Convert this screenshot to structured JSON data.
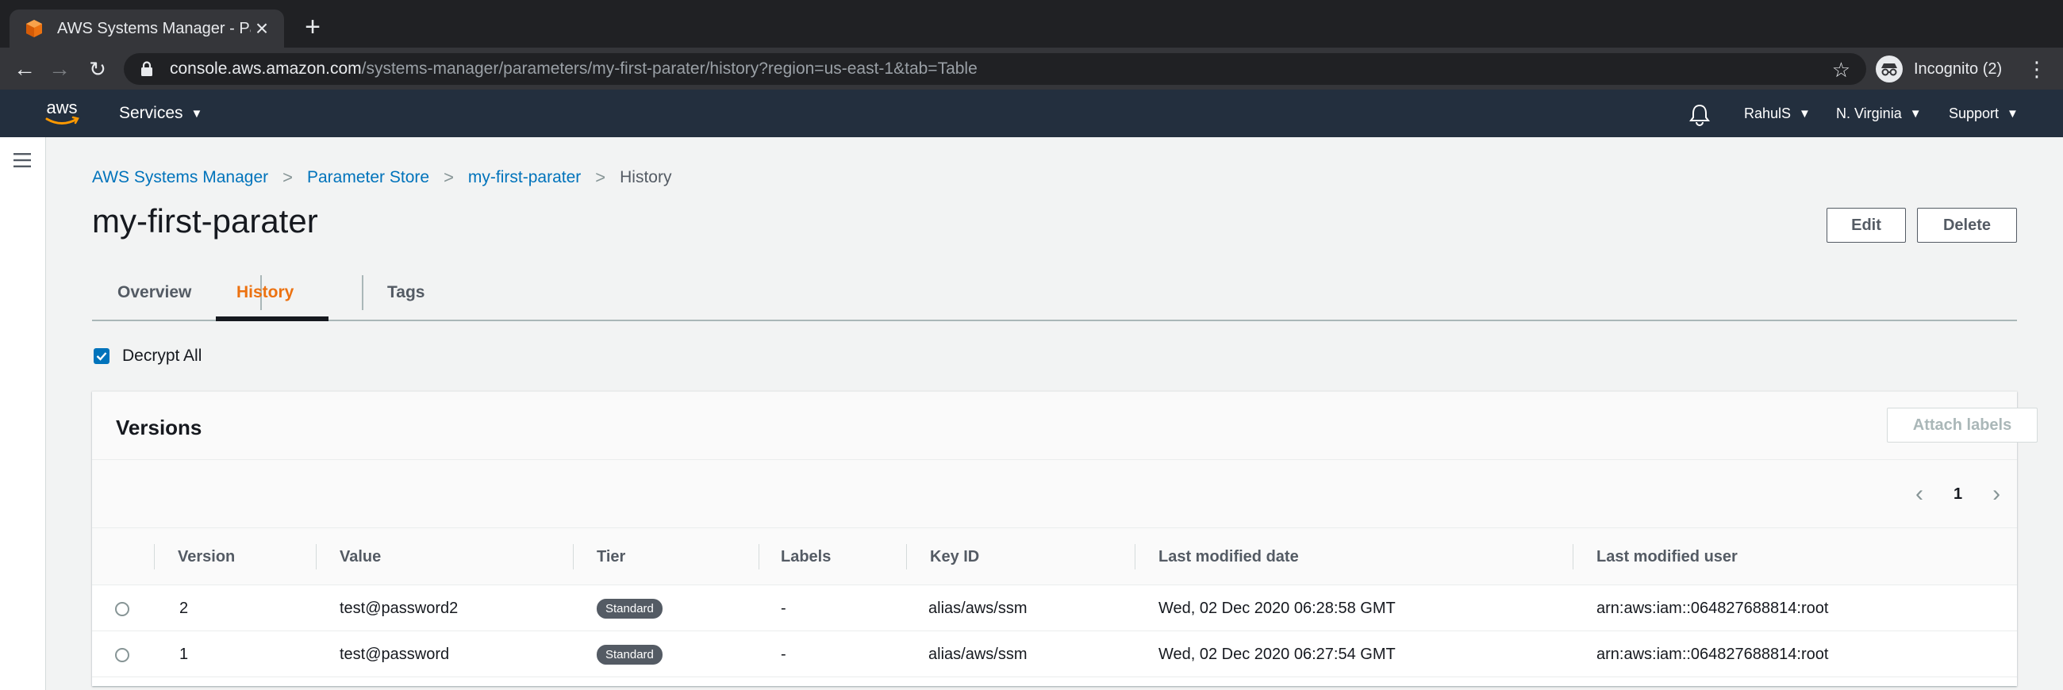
{
  "browser": {
    "tab_title": "AWS Systems Manager - Paran",
    "url_host": "console.aws.amazon.com",
    "url_path": "/systems-manager/parameters/my-first-parater/history?region=us-east-1&tab=Table",
    "incognito_label": "Incognito (2)"
  },
  "awsbar": {
    "logo_text": "aws",
    "services_label": "Services",
    "user_label": "RahulS",
    "region_label": "N. Virginia",
    "support_label": "Support"
  },
  "breadcrumb": [
    {
      "label": "AWS Systems Manager"
    },
    {
      "label": "Parameter Store"
    },
    {
      "label": "my-first-parater"
    },
    {
      "label": "History"
    }
  ],
  "page": {
    "title": "my-first-parater",
    "edit_label": "Edit",
    "delete_label": "Delete"
  },
  "tabs": [
    {
      "label": "Overview",
      "active": false
    },
    {
      "label": "History",
      "active": true
    },
    {
      "label": "Tags",
      "active": false
    }
  ],
  "decrypt": {
    "label": "Decrypt All",
    "checked": true
  },
  "versions": {
    "title": "Versions",
    "attach_label": "Attach labels",
    "current_page": "1",
    "columns": [
      "Version",
      "Value",
      "Tier",
      "Labels",
      "Key ID",
      "Last modified date",
      "Last modified user"
    ],
    "rows": [
      {
        "version": "2",
        "value": "test@password2",
        "tier": "Standard",
        "labels": "-",
        "key_id": "alias/aws/ssm",
        "date": "Wed, 02 Dec 2020 06:28:58 GMT",
        "user": "arn:aws:iam::064827688814:root"
      },
      {
        "version": "1",
        "value": "test@password",
        "tier": "Standard",
        "labels": "-",
        "key_id": "alias/aws/ssm",
        "date": "Wed, 02 Dec 2020 06:27:54 GMT",
        "user": "arn:aws:iam::064827688814:root"
      }
    ]
  },
  "colors": {
    "aws_nav": "#232f3e",
    "link": "#0073bb",
    "active_tab": "#ec7211",
    "aws_orange": "#ff9900"
  }
}
